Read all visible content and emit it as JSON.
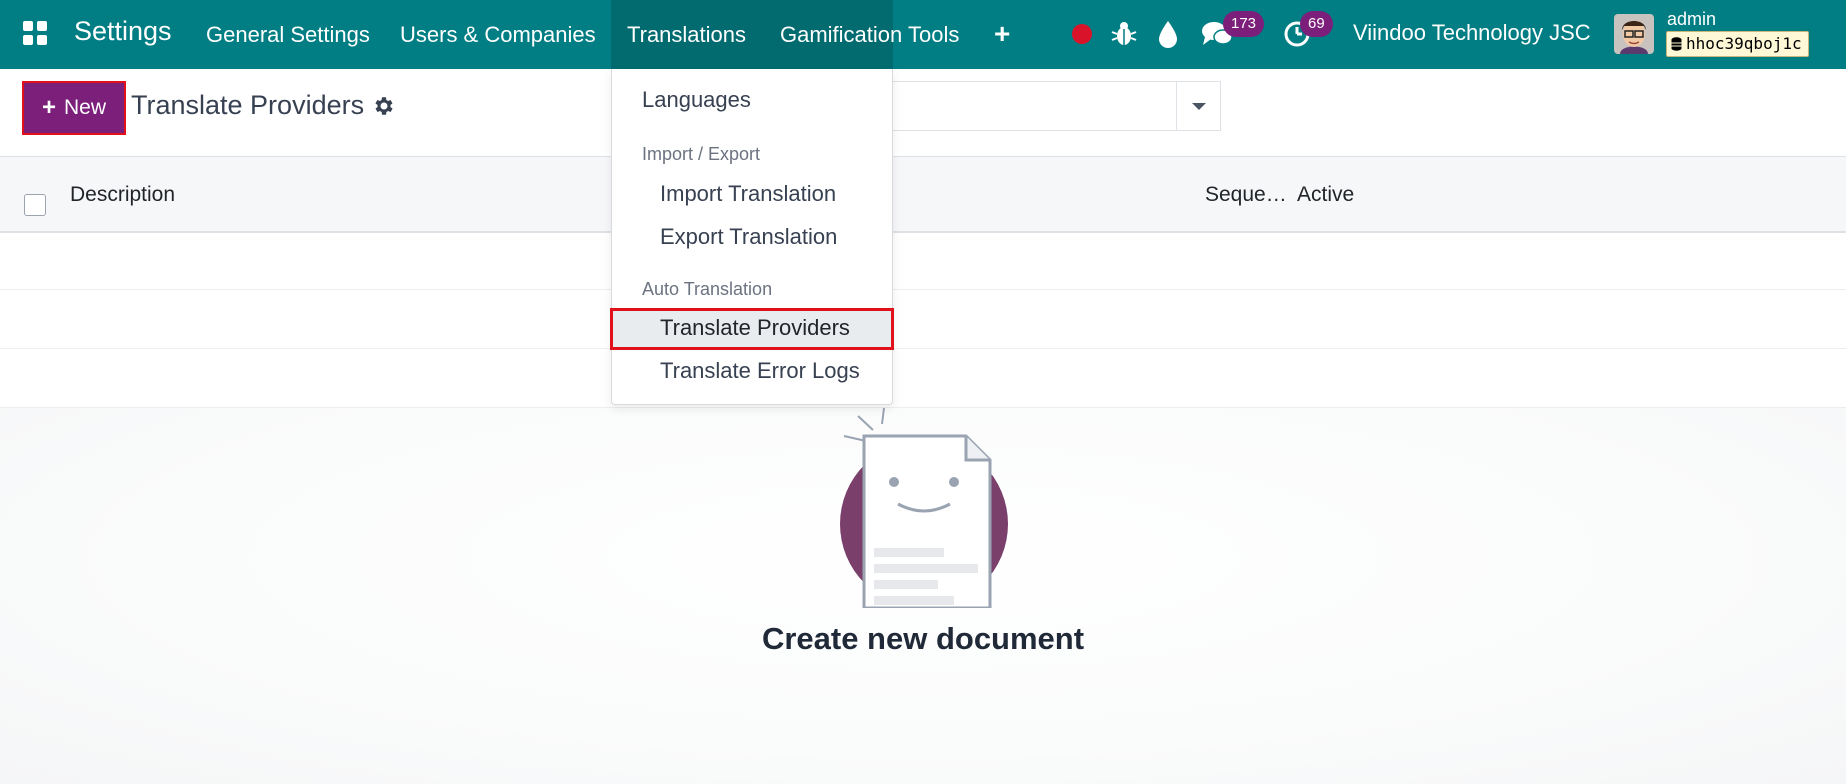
{
  "navbar": {
    "app_title": "Settings",
    "menus": [
      "General Settings",
      "Users & Companies",
      "Translations",
      "Gamification Tools"
    ],
    "active_menu": "Translations",
    "messages_count": "173",
    "activities_count": "69",
    "company": "Viindoo Technology JSC",
    "user": "admin",
    "database": "hhoc39qboj1c",
    "colors": {
      "bar": "#017e84",
      "active": "#016b70",
      "badge": "#7b1f7a",
      "record_dot": "#d9142a"
    }
  },
  "control_panel": {
    "new_button": "New",
    "title": "Translate Providers",
    "search_placeholder": ""
  },
  "list": {
    "columns": [
      "Description",
      "Seque…",
      "Active"
    ]
  },
  "dropdown": {
    "languages": "Languages",
    "section_import_export": "Import / Export",
    "import_translation": "Import Translation",
    "export_translation": "Export Translation",
    "section_auto_translation": "Auto Translation",
    "translate_providers": "Translate Providers",
    "translate_error_logs": "Translate Error Logs",
    "highlighted_item": "Translate Providers"
  },
  "empty_state": {
    "title": "Create new document"
  },
  "accent": {
    "primary": "#7b1f7a",
    "highlight_border": "#e0111b"
  }
}
